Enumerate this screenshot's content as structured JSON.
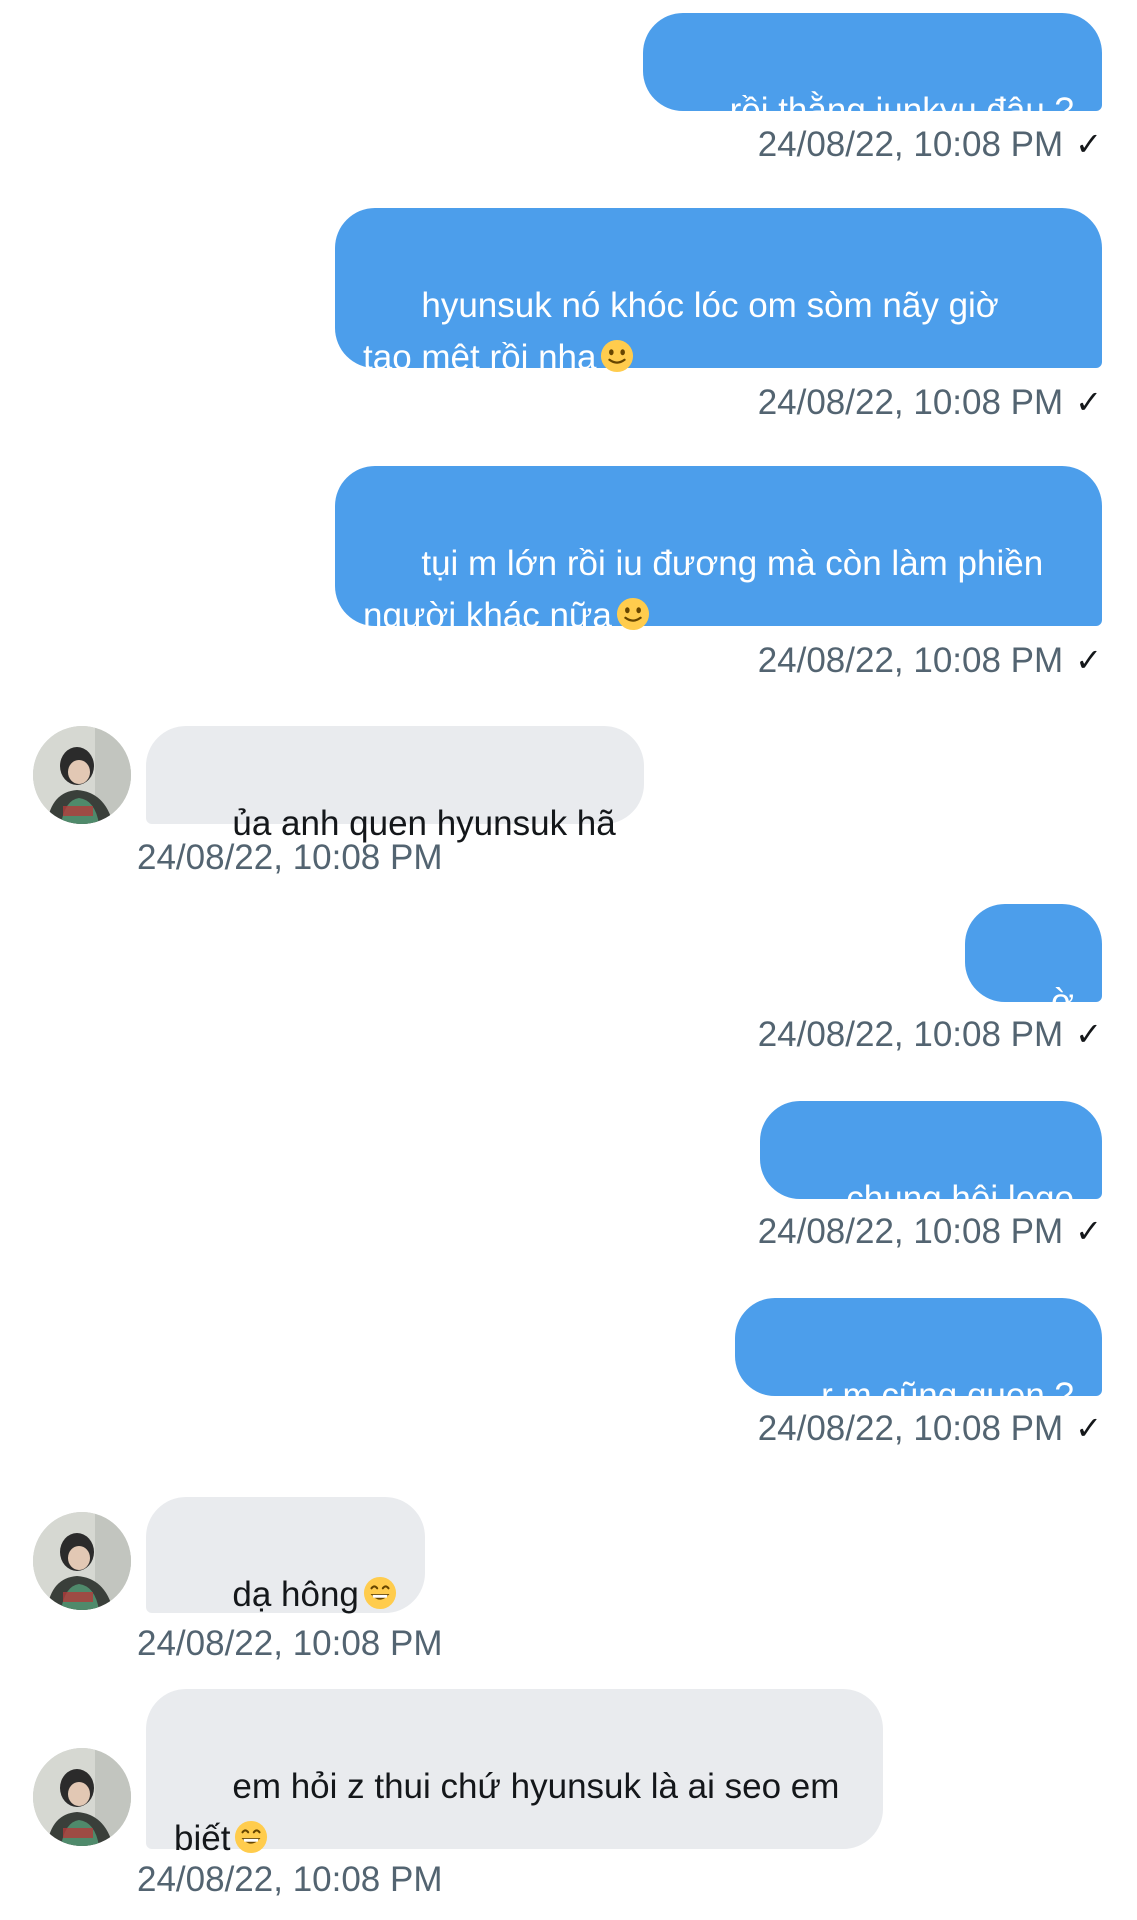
{
  "messages": [
    {
      "side": "sent",
      "text": "rồi thằng junkyu đâu ?",
      "time": "24/08/22, 10:08 PM",
      "status_icon": "checkmark-icon"
    },
    {
      "side": "sent",
      "text": "hyunsuk nó khóc lóc om sòm nãy giờ\ntao mệt rồi nha",
      "emoji": "slightly-smiling-face",
      "time": "24/08/22, 10:08 PM",
      "status_icon": "checkmark-icon"
    },
    {
      "side": "sent",
      "text": "tụi m lớn rồi iu đương mà còn làm phiền\nngười khác nữa",
      "emoji": "slightly-smiling-face",
      "time": "24/08/22, 10:08 PM",
      "status_icon": "checkmark-icon"
    },
    {
      "side": "received",
      "text": "ủa anh quen hyunsuk hã",
      "time": "24/08/22, 10:08 PM"
    },
    {
      "side": "sent",
      "text": "ờ",
      "time": "24/08/22, 10:08 PM",
      "status_icon": "checkmark-icon"
    },
    {
      "side": "sent",
      "text": "chung hội lego",
      "time": "24/08/22, 10:08 PM",
      "status_icon": "checkmark-icon"
    },
    {
      "side": "sent",
      "text": "r m cũng quen ?",
      "time": "24/08/22, 10:08 PM",
      "status_icon": "checkmark-icon"
    },
    {
      "side": "received",
      "text": "dạ hông",
      "emoji": "grinning-face",
      "time": "24/08/22, 10:08 PM"
    },
    {
      "side": "received",
      "text": "em hỏi z thui chứ hyunsuk là ai seo em\nbiết",
      "emoji": "grinning-face",
      "time": "24/08/22, 10:08 PM"
    }
  ],
  "colors": {
    "sent_bubble": "#4c9eeb",
    "received_bubble": "#e9ebee",
    "timestamp": "#536471"
  }
}
